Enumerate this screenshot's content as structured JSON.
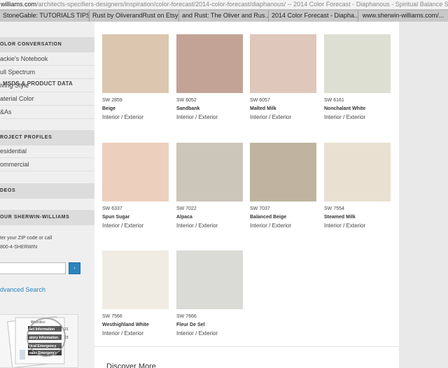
{
  "browser": {
    "url_host": "williams.com",
    "url_path": "/architects-specifiers-designers/inspiration/color-forecast/2014-color-forecast/diaphanous/ -- 2014 Color Forecast - Diaphanous - Spiritual Balance Simplicity - Sherwin...",
    "tabs": [
      "StoneGable: TUTORIALS TIPS...",
      "Rust by OliverandRust on Etsy",
      "and Rust: The Oliver and Rus...",
      "2014 Color Forecast - Diapha...",
      "www.sherwin-williams.com/..."
    ]
  },
  "sidebar": {
    "color_conversation": {
      "heading": "OLOR CONVERSATION",
      "items": [
        "ackie's Notebook",
        "ull Spectrum",
        "iving Style",
        "aterial Color",
        "&As"
      ]
    },
    "project_profiles": {
      "heading": "ROJECT PROFILES",
      "items": [
        "esidential",
        "ommercial"
      ]
    },
    "videos_heading": "DEOS",
    "your_sw": {
      "heading": "OUR SHERWIN-WILLIAMS",
      "line1": "ter your ZIP code or call",
      "line2": "800-4-SHERWIN",
      "go_label": "›",
      "zip_placeholder": "",
      "advanced_search": "dvanced Search"
    },
    "msds": {
      "label": "MSDS & PRODUCT DATA",
      "doc_lines": [
        "Websites",
        "act Information",
        "atory Information",
        "tical Emergency",
        "ease Emergency"
      ],
      "doc_numbers": [
        "21",
        "23"
      ]
    }
  },
  "colors": [
    {
      "code": "SW 2859",
      "name": "Beige",
      "use": "Interior / Exterior",
      "hex": "#dcc6af"
    },
    {
      "code": "SW 6052",
      "name": "Sandbank",
      "use": "Interior / Exterior",
      "hex": "#c3a395"
    },
    {
      "code": "SW 6057",
      "name": "Malted Milk",
      "use": "Interior / Exterior",
      "hex": "#dfc7bb"
    },
    {
      "code": "SW 6161",
      "name": "Nonchalant White",
      "use": "Interior / Exterior",
      "hex": "#dedfd3"
    },
    {
      "code": "SW 6337",
      "name": "Spun Sugar",
      "use": "Interior / Exterior",
      "hex": "#ecd0bd"
    },
    {
      "code": "SW 7022",
      "name": "Alpaca",
      "use": "Interior / Exterior",
      "hex": "#ccc5b9"
    },
    {
      "code": "SW 7037",
      "name": "Balanced Beige",
      "use": "Interior / Exterior",
      "hex": "#c0b4a0"
    },
    {
      "code": "SW 7554",
      "name": "Steamed Milk",
      "use": "Interior / Exterior",
      "hex": "#e9e0d1"
    },
    {
      "code": "SW 7566",
      "name": "Westhighland White",
      "use": "Interior / Exterior",
      "hex": "#f0ece3"
    },
    {
      "code": "SW 7666",
      "name": "Fleur De Sel",
      "use": "Interior / Exterior",
      "hex": "#dadad6"
    }
  ],
  "footer": {
    "discover_more": "Discover More"
  }
}
